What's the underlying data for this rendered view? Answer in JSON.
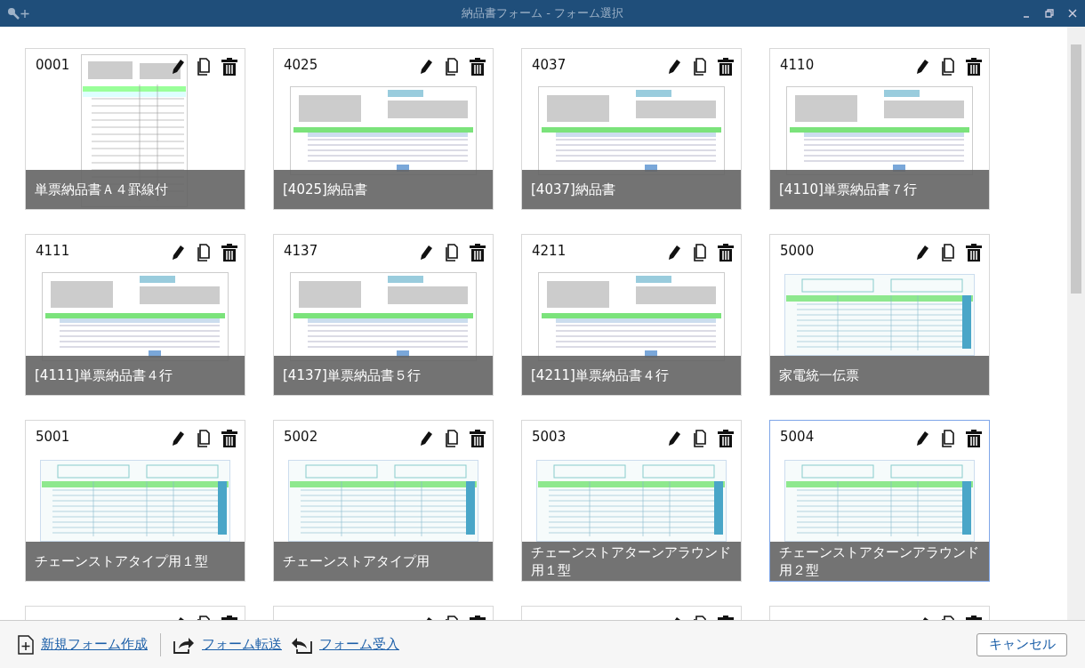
{
  "window": {
    "title": "納品書フォーム - フォーム選択"
  },
  "forms": [
    {
      "code": "0001",
      "name": "単票納品書Ａ４罫線付",
      "kind": "portrait",
      "selected": false
    },
    {
      "code": "4025",
      "name": "[4025]納品書",
      "kind": "landscape",
      "selected": false
    },
    {
      "code": "4037",
      "name": "[4037]納品書",
      "kind": "landscape",
      "selected": false
    },
    {
      "code": "4110",
      "name": "[4110]単票納品書７行",
      "kind": "landscape",
      "selected": false
    },
    {
      "code": "4111",
      "name": "[4111]単票納品書４行",
      "kind": "landscape",
      "selected": false
    },
    {
      "code": "4137",
      "name": "[4137]単票納品書５行",
      "kind": "landscape",
      "selected": false
    },
    {
      "code": "4211",
      "name": "[4211]単票納品書４行",
      "kind": "landscape",
      "selected": false
    },
    {
      "code": "5000",
      "name": "家電統一伝票",
      "kind": "chain",
      "selected": false
    },
    {
      "code": "5001",
      "name": "チェーンストアタイプ用１型",
      "kind": "chain",
      "selected": false
    },
    {
      "code": "5002",
      "name": "チェーンストアタイプ用",
      "kind": "chain",
      "selected": false
    },
    {
      "code": "5003",
      "name": "チェーンストアターンアラウンド用１型",
      "kind": "chain",
      "selected": false
    },
    {
      "code": "5004",
      "name": "チェーンストアターンアラウンド用２型",
      "kind": "chain",
      "selected": true
    },
    {
      "kind": "hidden",
      "selected": false
    },
    {
      "kind": "hidden",
      "selected": false
    },
    {
      "kind": "hidden",
      "selected": false
    },
    {
      "kind": "hidden",
      "selected": false
    }
  ],
  "footer": {
    "links": [
      {
        "label": "新規フォーム作成",
        "kind": "new"
      },
      {
        "label": "フォーム転送",
        "kind": "export"
      },
      {
        "label": "フォーム受入",
        "kind": "import"
      }
    ],
    "cancel": "キャンセル"
  }
}
